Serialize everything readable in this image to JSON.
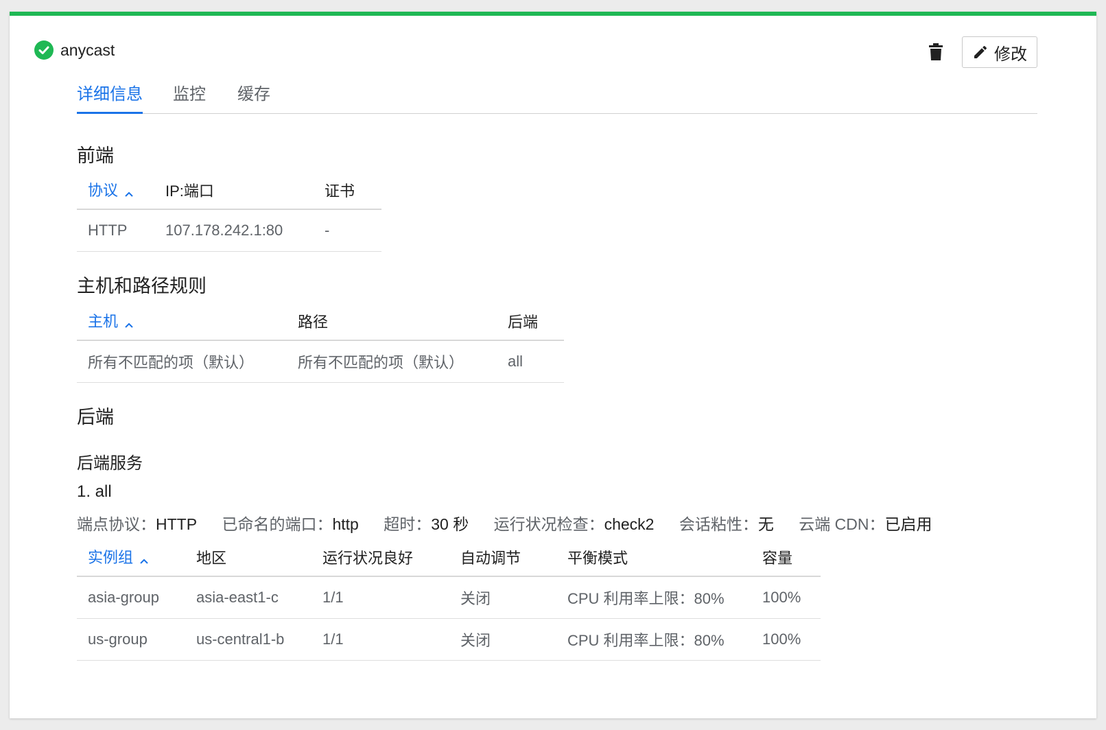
{
  "header": {
    "title": "anycast",
    "edit_label": "修改"
  },
  "tabs": [
    {
      "label": "详细信息"
    },
    {
      "label": "监控"
    },
    {
      "label": "缓存"
    }
  ],
  "frontend": {
    "title": "前端",
    "columns": [
      "协议",
      "IP:端口",
      "证书"
    ],
    "rows": [
      [
        "HTTP",
        "107.178.242.1:80",
        "-"
      ]
    ]
  },
  "host_rules": {
    "title": "主机和路径规则",
    "columns": [
      "主机",
      "路径",
      "后端"
    ],
    "rows": [
      [
        "所有不匹配的项（默认）",
        "所有不匹配的项（默认）",
        "all"
      ]
    ]
  },
  "backend": {
    "title": "后端",
    "services_title": "后端服务",
    "service_name": "1. all",
    "props": [
      {
        "key": "端点协议：",
        "value": "HTTP"
      },
      {
        "key": "已命名的端口：",
        "value": "http"
      },
      {
        "key": "超时：",
        "value": "30 秒"
      },
      {
        "key": "运行状况检查：",
        "value": "check2"
      },
      {
        "key": "会话粘性：",
        "value": "无"
      },
      {
        "key": "云端 CDN：",
        "value": "已启用"
      }
    ],
    "columns": [
      "实例组",
      "地区",
      "运行状况良好",
      "自动调节",
      "平衡模式",
      "容量"
    ],
    "rows": [
      [
        "asia-group",
        "asia-east1-c",
        "1/1",
        "关闭",
        "CPU 利用率上限：80%",
        "100%"
      ],
      [
        "us-group",
        "us-central1-b",
        "1/1",
        "关闭",
        "CPU 利用率上限：80%",
        "100%"
      ]
    ]
  },
  "colors": {
    "accent": "#1a73e8",
    "status_green": "#1fb854"
  },
  "icons": {
    "status": "check-circle-icon",
    "delete": "trash-icon",
    "edit": "pencil-icon",
    "sort": "chevron-up-icon"
  }
}
